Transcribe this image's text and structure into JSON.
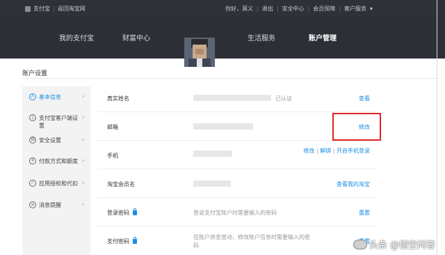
{
  "topbar": {
    "logo_text": "支付宝",
    "back_link": "返回淘宝网",
    "greeting": "你好，莫义",
    "logout": "退出",
    "security_center": "安全中心",
    "member_protection": "会员保障",
    "customer_service": "客户服务",
    "dropdown_icon": "caret-down-icon"
  },
  "nav": {
    "items": [
      "我的支付宝",
      "财富中心",
      "生活服务",
      "账户管理"
    ],
    "active": "账户管理"
  },
  "page_title": "账户设置",
  "sidebar": {
    "items": [
      {
        "label": "基本信息",
        "icon": "person-icon",
        "active": true
      },
      {
        "label": "支付宝客户端设置",
        "icon": "mobile-icon",
        "active": false
      },
      {
        "label": "安全设置",
        "icon": "lock-icon",
        "active": false
      },
      {
        "label": "付款方式和额度",
        "icon": "yen-icon",
        "active": false
      },
      {
        "label": "应用授权和代扣",
        "icon": "check-icon",
        "active": false
      },
      {
        "label": "消息提醒",
        "icon": "message-icon",
        "active": false
      }
    ]
  },
  "rows": [
    {
      "label": "真实姓名",
      "value": "已认证",
      "actions": [
        "查看"
      ]
    },
    {
      "label": "邮箱",
      "value": "",
      "actions": [
        "修改"
      ]
    },
    {
      "label": "手机",
      "value": "",
      "actions": [
        "修改",
        "解绑",
        "开启手机登录"
      ]
    },
    {
      "label": "淘宝会员名",
      "value": "",
      "actions": [
        "查看我的淘宝"
      ]
    },
    {
      "label": "登录密码",
      "value": "登录支付宝账户时需要输入的密码",
      "actions": [
        "重置"
      ]
    },
    {
      "label": "支付密码",
      "value": "在账户资金变动，修改账户信息时需要输入的密码",
      "actions": [
        "重置"
      ]
    }
  ],
  "colors": {
    "link": "#1a8fe6",
    "highlight_box": "#e02020",
    "topbar_bg": "#2e3138"
  },
  "watermark": "头条 @悟空问答"
}
